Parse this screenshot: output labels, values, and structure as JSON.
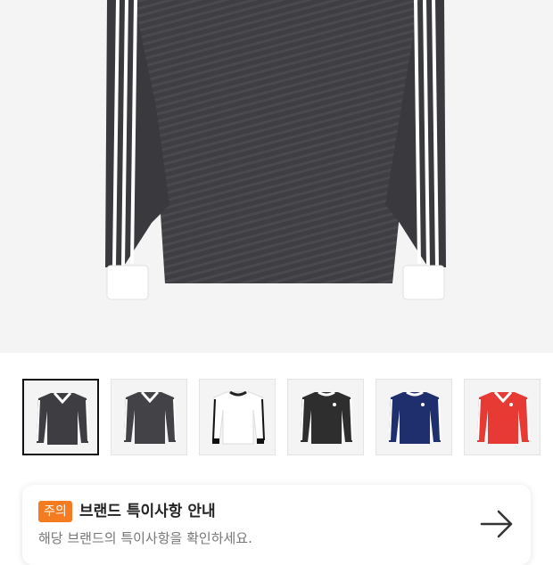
{
  "product": {
    "main_image": {
      "icon": "shirt-image",
      "shirt_color": "#3d3c40"
    }
  },
  "thumbnails": [
    {
      "icon": "shirt-thumbnail",
      "color": "#3e3d42",
      "selected": true
    },
    {
      "icon": "shirt-thumbnail",
      "color": "#434247",
      "selected": false
    },
    {
      "icon": "shirt-thumbnail",
      "color": "#ffffff",
      "selected": false
    },
    {
      "icon": "shirt-thumbnail",
      "color": "#2e2e2e",
      "selected": false
    },
    {
      "icon": "shirt-thumbnail",
      "color": "#1f2f6e",
      "selected": false
    },
    {
      "icon": "shirt-thumbnail",
      "color": "#e83a34",
      "selected": false
    }
  ],
  "notice": {
    "badge": "주의",
    "title": "브랜드 특이사항 안내",
    "subtitle": "해당 브랜드의 특이사항을 확인하세요.",
    "arrow_icon": "arrow-right-icon",
    "badge_color": "#f47b20"
  }
}
